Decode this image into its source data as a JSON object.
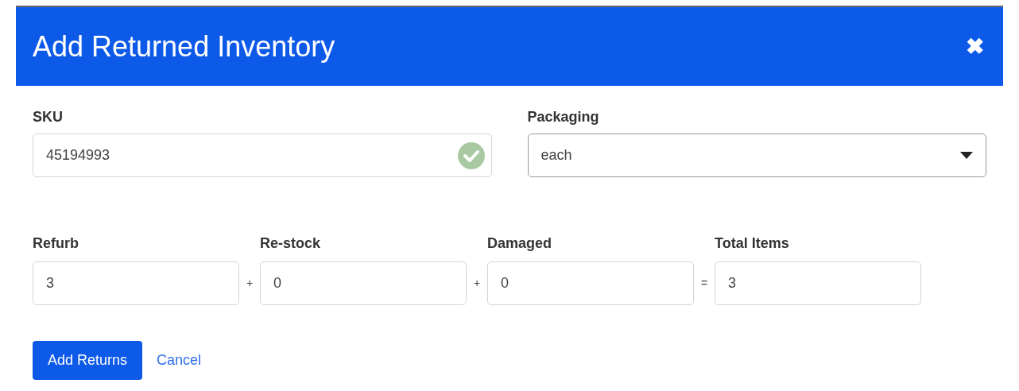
{
  "dialog": {
    "title": "Add Returned Inventory",
    "close": "✖"
  },
  "sku": {
    "label": "SKU",
    "value": "45194993",
    "valid": true
  },
  "packaging": {
    "label": "Packaging",
    "value": "each"
  },
  "quantities": [
    {
      "label": "Refurb",
      "value": "3",
      "operator": "+"
    },
    {
      "label": "Re-stock",
      "value": "0",
      "operator": "+"
    },
    {
      "label": "Damaged",
      "value": "0",
      "operator": "="
    },
    {
      "label": "Total Items",
      "value": "3"
    }
  ],
  "buttons": {
    "submit": "Add Returns",
    "cancel": "Cancel"
  }
}
